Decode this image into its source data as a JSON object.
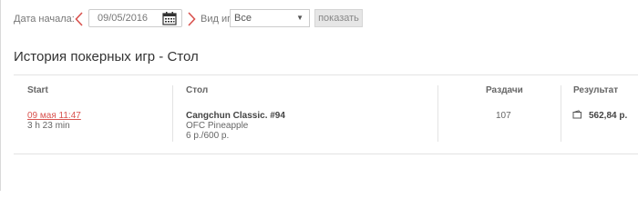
{
  "filters": {
    "date_start_label": "Дата начала:",
    "date_value": "09/05/2016",
    "game_type_label": "Вид игры:",
    "game_type_selected": "Все",
    "show_button": "показать"
  },
  "page_title": "История покерных игр - Стол",
  "table": {
    "columns": [
      "Start",
      "Стол",
      "Раздачи",
      "Результат"
    ],
    "rows": [
      {
        "start_date": "09 мая 11:47",
        "duration": "3 h 23 min",
        "table_name": "Cangchun Classic. #94",
        "game": "OFC Pineapple",
        "stakes": "6 р./600 р.",
        "hands": "107",
        "result": "562,84 р."
      }
    ]
  },
  "colors": {
    "accent_red": "#d9534f",
    "border": "#e3e3e3",
    "text": "#333333"
  },
  "icons": [
    "chevron-left-icon",
    "calendar-icon",
    "chevron-right-icon",
    "dropdown-arrow-icon",
    "wallet-icon"
  ]
}
